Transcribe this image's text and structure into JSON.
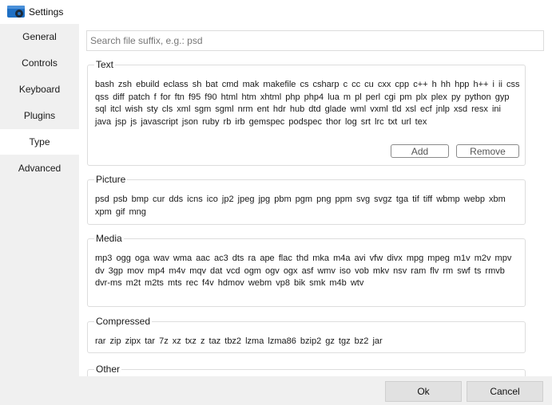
{
  "window": {
    "title": "Settings",
    "icon": "settings-app-icon"
  },
  "sidebar": {
    "items": [
      {
        "label": "General",
        "active": false
      },
      {
        "label": "Controls",
        "active": false
      },
      {
        "label": "Keyboard",
        "active": false
      },
      {
        "label": "Plugins",
        "active": false
      },
      {
        "label": "Type",
        "active": true
      },
      {
        "label": "Advanced",
        "active": false
      }
    ]
  },
  "search": {
    "placeholder": "Search file suffix, e.g.: psd",
    "value": ""
  },
  "groups": {
    "text": {
      "title": "Text",
      "extensions": "bash zsh ebuild eclass sh bat cmd mak makefile cs csharp c cc cu cxx cpp c++ h hh hpp h++ i ii css qss diff patch f for ftn f95 f90 html htm xhtml php php4 lua m pl perl cgi pm plx plex py python gyp sql itcl wish sty cls xml sgm sgml nrm ent hdr hub dtd glade wml vxml tld xsl ecf jnlp xsd resx ini java jsp js javascript json ruby rb irb gemspec podspec thor log srt lrc txt url tex",
      "add_label": "Add",
      "remove_label": "Remove"
    },
    "picture": {
      "title": "Picture",
      "extensions": "psd psb bmp cur dds icns ico jp2 jpeg jpg pbm pgm png ppm svg svgz tga tif tiff wbmp webp xbm xpm gif mng"
    },
    "media": {
      "title": "Media",
      "extensions": "mp3 ogg oga wav wma aac ac3 dts ra ape flac thd mka m4a avi vfw divx mpg mpeg m1v m2v mpv dv 3gp mov mp4 m4v mqv dat vcd ogm ogv ogx asf wmv iso vob mkv nsv ram flv rm swf ts rmvb dvr-ms m2t m2ts mts rec f4v hdmov webm vp8 bik smk m4b wtv"
    },
    "compressed": {
      "title": "Compressed",
      "extensions": "rar zip zipx tar 7z xz txz z taz tbz2 lzma lzma86 bzip2 gz tgz bz2 jar"
    },
    "other": {
      "title": "Other"
    }
  },
  "footer": {
    "ok_label": "Ok",
    "cancel_label": "Cancel"
  },
  "colors": {
    "sidebar_bg": "#f0f0f0",
    "footer_bg": "#f0f0f0",
    "button_bg": "#e1e1e1",
    "icon_blue": "#1e6fc4"
  }
}
